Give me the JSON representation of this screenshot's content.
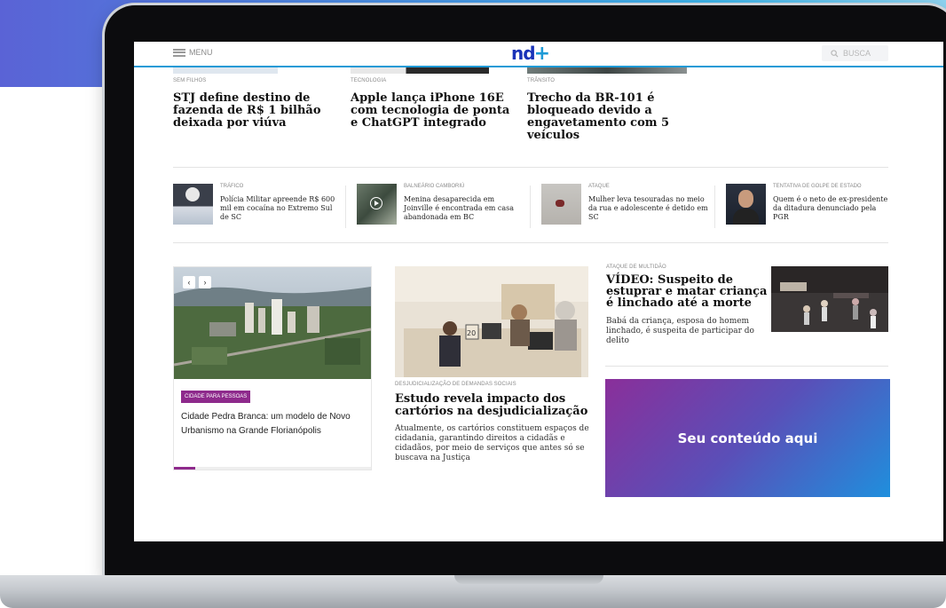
{
  "header": {
    "menu_label": "MENU",
    "logo_text": "nd",
    "logo_plus": "+",
    "search_placeholder": "BUSCA"
  },
  "top_articles": [
    {
      "category": "SEM FILHOS",
      "title": "STJ define destino de fazenda de R$ 1 bilhão deixada por viúva"
    },
    {
      "category": "TECNOLOGIA",
      "title": "Apple lança iPhone 16E com tecnologia de ponta e ChatGPT integrado"
    },
    {
      "category": "TRÂNSITO",
      "title": "Trecho da BR-101 é bloqueado devido a engavetamento com 5 veículos"
    }
  ],
  "small_articles": [
    {
      "category": "TRÁFICO",
      "title": "Polícia Militar apreende R$ 600 mil em cocaína no Extremo Sul de SC"
    },
    {
      "category": "BALNEÁRIO CAMBORIÚ",
      "title": "Menina desaparecida em Joinville é encontrada em casa abandonada em BC"
    },
    {
      "category": "ATAQUE",
      "title": "Mulher leva tesouradas no meio da rua e adolescente é detido em SC"
    },
    {
      "category": "TENTATIVA DE GOLPE DE ESTADO",
      "title": "Quem é o neto de ex-presidente da ditadura denunciado pela PGR"
    }
  ],
  "carousel": {
    "prev": "‹",
    "next": "›",
    "badge": "CIDADE PARA PESSOAS",
    "title": "Cidade Pedra Branca: um modelo de Novo Urbanismo na Grande Florianópolis"
  },
  "middle_article": {
    "category": "DESJUDICIALIZAÇÃO DE DEMANDAS SOCIAIS",
    "title": "Estudo revela impacto dos cartórios na desjudicialização",
    "description": "Atualmente, os cartórios constituem espaços de cidadania, garantindo direitos a cidadãs e cidadãos, por meio de serviços que antes só se buscava na Justiça"
  },
  "right_article": {
    "category": "ATAQUE DE MULTIDÃO",
    "title": "VÍDEO: Suspeito de estuprar e matar criança é linchado até a morte",
    "description": "Babá da criança, esposa do homem linchado, é suspeita de participar do delito"
  },
  "ad": {
    "text": "Seu conteúdo aqui"
  },
  "colors": {
    "brand_blue": "#1a33b8",
    "accent_cyan": "#1e9ad6",
    "badge_purple": "#8e2a8c"
  }
}
